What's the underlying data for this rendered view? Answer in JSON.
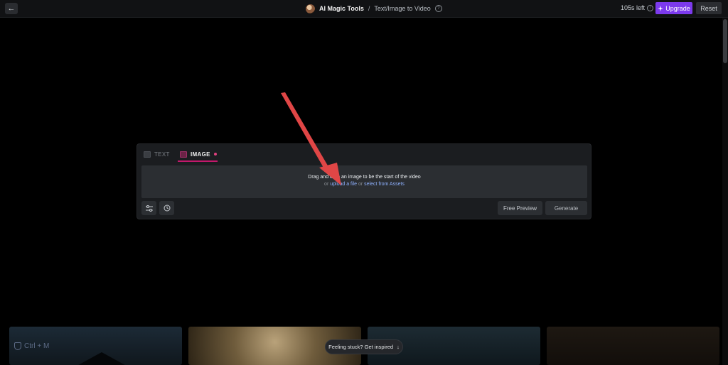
{
  "header": {
    "back_icon": "arrow-left-icon",
    "breadcrumb_root": "AI Magic Tools",
    "breadcrumb_separator": "/",
    "breadcrumb_current": "Text/Image to Video",
    "help_icon": "question-circle-icon",
    "time_left": "105s left",
    "info_icon": "info-circle-icon",
    "upgrade_label": "Upgrade",
    "reset_label": "Reset"
  },
  "composer": {
    "tabs": [
      {
        "label": "TEXT",
        "icon": "text-icon",
        "active": false
      },
      {
        "label": "IMAGE",
        "icon": "image-icon",
        "active": true
      }
    ],
    "dropzone": {
      "main": "Drag and drop an image to be the start of the video",
      "or1": "or",
      "upload_link": "upload a file",
      "or2": "or",
      "assets_link": "select from Assets"
    },
    "free_preview_label": "Free Preview",
    "generate_label": "Generate"
  },
  "gallery": {
    "shortcut_hint": "Ctrl + M",
    "inspired_label": "Feeling stuck? Get inspired",
    "inspired_icon": "arrow-down-icon"
  },
  "colors": {
    "accent": "#7c3aed",
    "tab_underline": "#c2186b",
    "annotation_arrow": "#e04646"
  }
}
